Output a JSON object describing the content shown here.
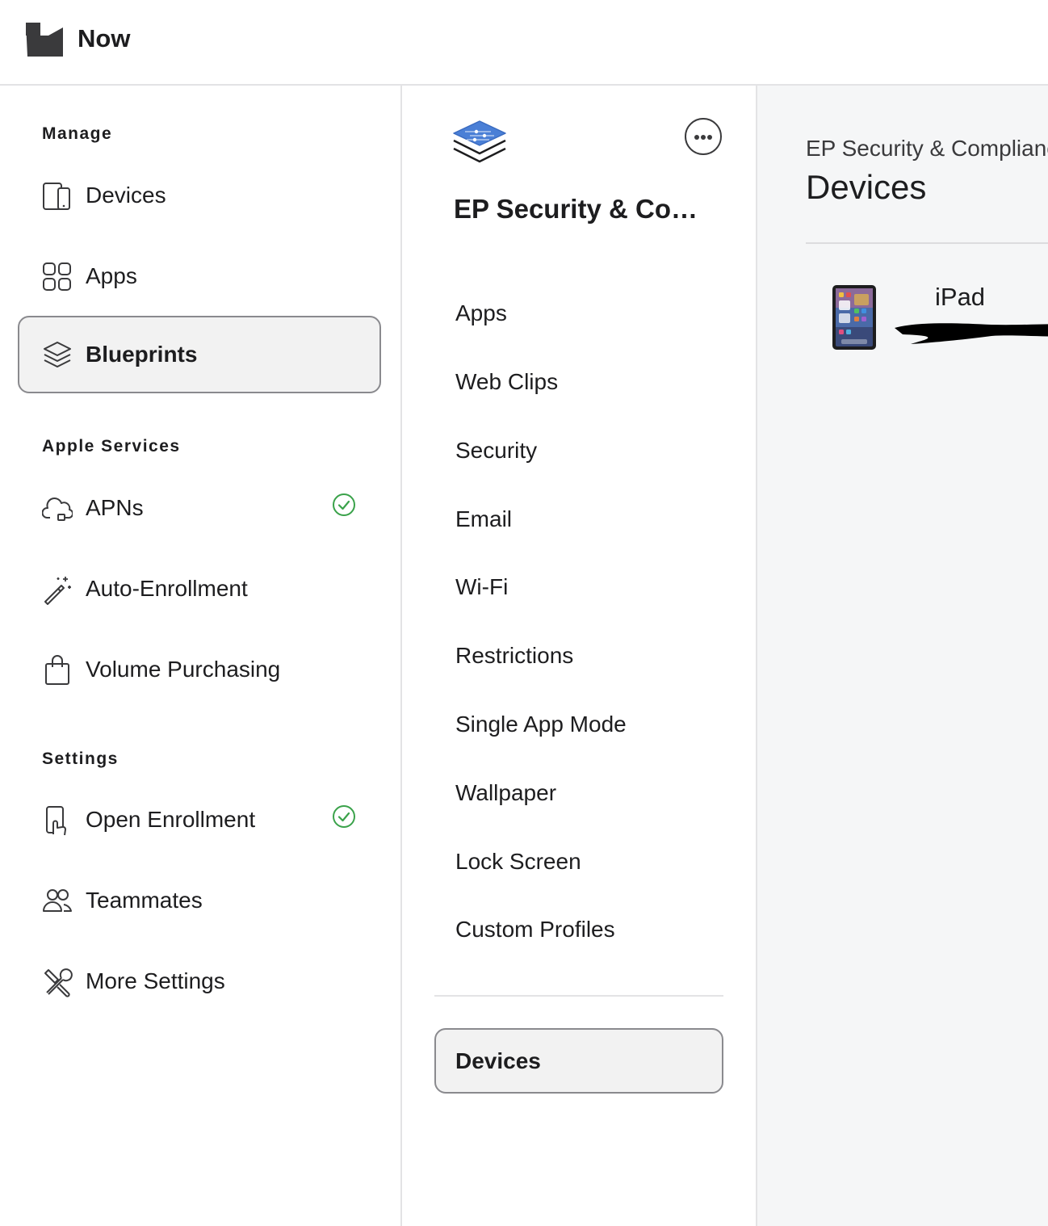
{
  "app": {
    "title": "Now"
  },
  "sidebar": {
    "sections": {
      "manage": "Manage",
      "apple_services": "Apple Services",
      "settings": "Settings"
    },
    "items": [
      {
        "label": "Devices",
        "icon": "devices-icon",
        "active": false
      },
      {
        "label": "Apps",
        "icon": "apps-grid-icon",
        "active": false
      },
      {
        "label": "Blueprints",
        "icon": "blueprints-stack-icon",
        "active": true
      },
      {
        "label": "APNs",
        "icon": "cloud-lock-icon",
        "status": "check-circle-icon"
      },
      {
        "label": "Auto-Enrollment",
        "icon": "magic-wand-icon"
      },
      {
        "label": "Volume Purchasing",
        "icon": "shopping-bag-icon"
      },
      {
        "label": "Open Enrollment",
        "icon": "phone-tap-icon",
        "status": "check-circle-icon"
      },
      {
        "label": "Teammates",
        "icon": "people-icon"
      },
      {
        "label": "More Settings",
        "icon": "tools-icon"
      }
    ]
  },
  "blueprint": {
    "name": "EP Security & Compliance",
    "icon": "blueprint-layers-icon",
    "more_icon": "ellipsis-circle-icon",
    "menu": [
      "Apps",
      "Web Clips",
      "Security",
      "Email",
      "Wi-Fi",
      "Restrictions",
      "Single App Mode",
      "Wallpaper",
      "Lock Screen",
      "Custom Profiles"
    ],
    "devices_tab": "Devices"
  },
  "panel": {
    "breadcrumb": "EP Security & Compliance",
    "title": "Devices",
    "devices": [
      {
        "name": "iPad",
        "icon": "ipad-thumbnail-icon"
      }
    ]
  },
  "colors": {
    "accent_blue": "#4a7fd6",
    "check_green": "#3aa24a",
    "active_border": "#8a8a8e",
    "panel_bg": "#f5f6f7"
  }
}
